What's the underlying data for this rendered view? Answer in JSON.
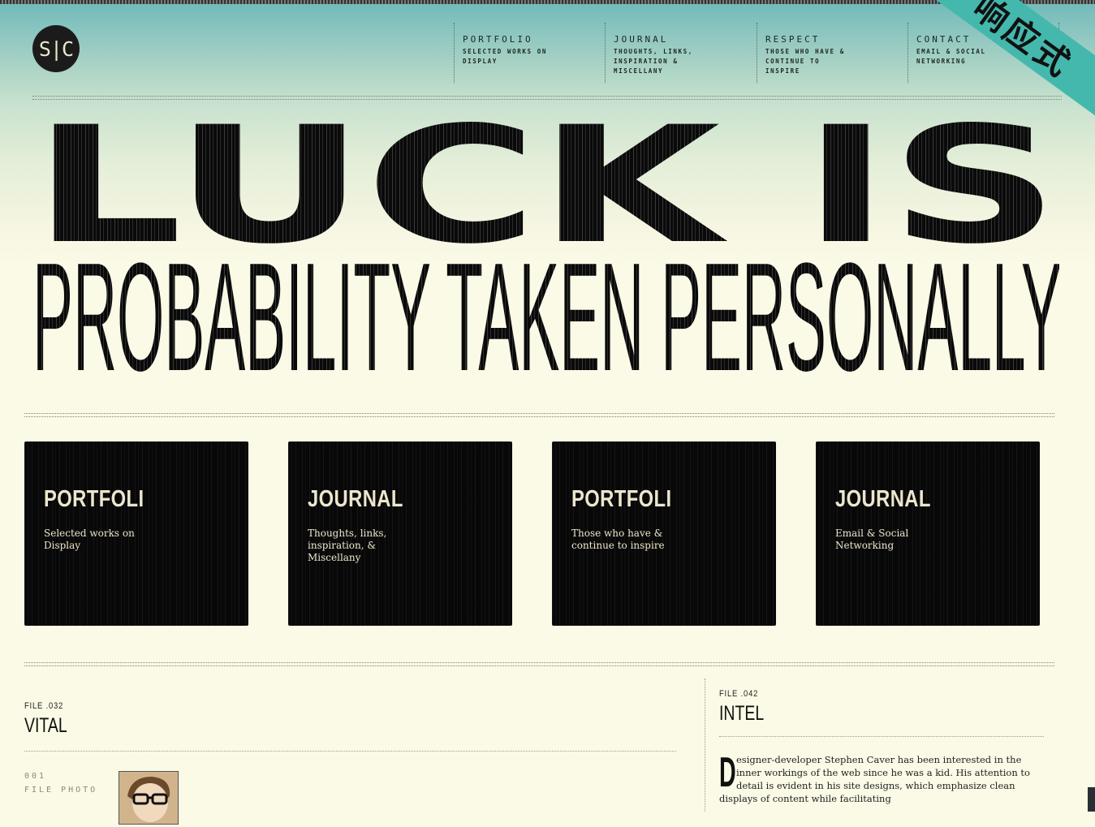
{
  "logo": {
    "text": "S|C"
  },
  "nav": [
    {
      "title": "PORTFOLIO",
      "sub": "SELECTED WORKS ON DISPLAY"
    },
    {
      "title": "JOURNAL",
      "sub": "THOUGHTS, LINKS, INSPIRATION & MISCELLANY"
    },
    {
      "title": "RESPECT",
      "sub": "THOSE WHO HAVE & CONTINUE TO INSPIRE"
    },
    {
      "title": "CONTACT",
      "sub": "EMAIL & SOCIAL NETWORKING"
    }
  ],
  "ribbon": {
    "text": "响应式"
  },
  "hero": {
    "line1": "LUCK IS",
    "line2": "PROBABILITY TAKEN PERSONALLY"
  },
  "cards": [
    {
      "title": "PORTFOLI",
      "text": "Selected works on Display"
    },
    {
      "title": "JOURNAL",
      "text": "Thoughts, links, inspiration, & Miscellany"
    },
    {
      "title": "PORTFOLI",
      "text": "Those who have & continue to inspire"
    },
    {
      "title": "JOURNAL",
      "text": "Email & Social Networking"
    }
  ],
  "vital": {
    "file": "FILE .032",
    "title": "VITAL",
    "photo_num": "001",
    "photo_label": "FILE PHOTO"
  },
  "intel": {
    "file": "FILE .042",
    "title": "INTEL",
    "dropcap": "D",
    "text": "esigner-developer Stephen Caver has been interested in the inner workings of the web since he was a kid. His attention to detail is evident in his site designs, which emphasize clean displays of content while facilitating"
  },
  "colors": {
    "background": "#fbfae6",
    "ribbon": "#45b8ad",
    "card": "#080808",
    "sky": "#6fb9b9"
  }
}
